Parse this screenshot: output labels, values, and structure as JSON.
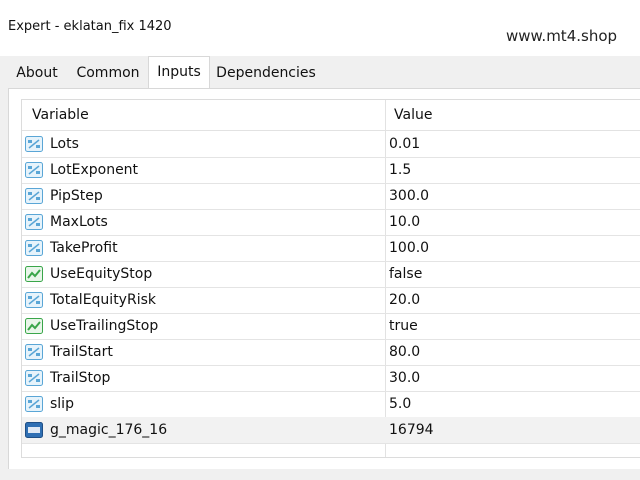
{
  "window": {
    "title": "Expert - eklatan_fix 1420"
  },
  "watermark": "www.mt4.shop",
  "tabs": [
    {
      "label": "About",
      "active": false
    },
    {
      "label": "Common",
      "active": false
    },
    {
      "label": "Inputs",
      "active": true
    },
    {
      "label": "Dependencies",
      "active": false
    }
  ],
  "table": {
    "headers": {
      "variable": "Variable",
      "value": "Value"
    },
    "rows": [
      {
        "name": "Lots",
        "value": "0.01",
        "icon": "double-value-icon"
      },
      {
        "name": "LotExponent",
        "value": "1.5",
        "icon": "double-value-icon"
      },
      {
        "name": "PipStep",
        "value": "300.0",
        "icon": "double-value-icon"
      },
      {
        "name": "MaxLots",
        "value": "10.0",
        "icon": "double-value-icon"
      },
      {
        "name": "TakeProfit",
        "value": "100.0",
        "icon": "double-value-icon"
      },
      {
        "name": "UseEquityStop",
        "value": "false",
        "icon": "bool-value-icon"
      },
      {
        "name": "TotalEquityRisk",
        "value": "20.0",
        "icon": "double-value-icon"
      },
      {
        "name": "UseTrailingStop",
        "value": "true",
        "icon": "bool-value-icon"
      },
      {
        "name": "TrailStart",
        "value": "80.0",
        "icon": "double-value-icon"
      },
      {
        "name": "TrailStop",
        "value": "30.0",
        "icon": "double-value-icon"
      },
      {
        "name": "slip",
        "value": "5.0",
        "icon": "double-value-icon"
      },
      {
        "name": "g_magic_176_16",
        "value": "16794",
        "icon": "integer-value-icon"
      }
    ]
  },
  "colors": {
    "double_icon": "#5aa6d6",
    "bool_icon": "#3aa64a",
    "int_icon": "#2f6fb3"
  }
}
